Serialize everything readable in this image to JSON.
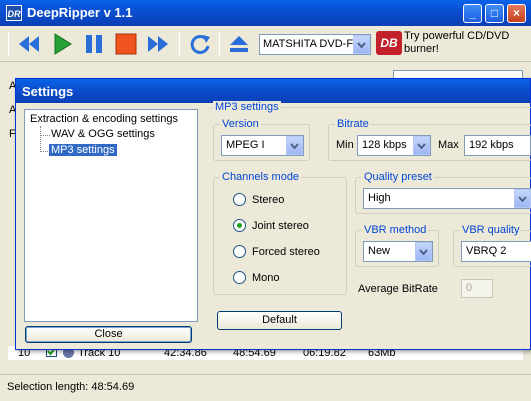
{
  "app": {
    "title": "DeepRipper v 1.1",
    "icon_text": "DR",
    "minimize": "_",
    "maximize": "□",
    "close": "×"
  },
  "toolbar": {
    "buttons": [
      "rewind-icon",
      "play-icon",
      "pause-icon",
      "stop-icon",
      "fast-forward-icon",
      "refresh-icon",
      "eject-icon"
    ],
    "drive": "MATSHITA DVD-F",
    "logo_text": "DB",
    "promo": "Try powerful CD/DVD burner!"
  },
  "background": {
    "labels": [
      "A",
      "A",
      "F"
    ],
    "track_row": {
      "num": "10",
      "name": "Track 10",
      "start": "42:34.86",
      "end": "48:54.69",
      "length": "06:19.82",
      "size": "63Mb"
    },
    "status": "Selection length:  48:54.69"
  },
  "settings": {
    "title": "Settings",
    "tree": {
      "root": "Extraction & encoding settings",
      "children": [
        "WAV & OGG settings",
        "MP3 settings"
      ],
      "selected": "MP3 settings"
    },
    "close_button": "Close",
    "mp3_group": "MP3 settings",
    "version": {
      "label": "Version",
      "value": "MPEG I"
    },
    "bitrate": {
      "label": "Bitrate",
      "min_label": "Min",
      "min": "128 kbps",
      "max_label": "Max",
      "max": "192 kbps"
    },
    "channels": {
      "label": "Channels mode",
      "options": [
        "Stereo",
        "Joint stereo",
        "Forced stereo",
        "Mono"
      ],
      "selected": "Joint stereo"
    },
    "quality": {
      "label": "Quality preset",
      "value": "High"
    },
    "vbr_method": {
      "label": "VBR method",
      "value": "New"
    },
    "vbr_quality": {
      "label": "VBR quality",
      "value": "VBRQ 2"
    },
    "avg_bitrate": {
      "label": "Average BitRate",
      "value": "0"
    },
    "default_button": "Default"
  },
  "colors": {
    "titlebar": "#0a4fd1",
    "selection": "#316ac5",
    "group_label": "#0046d5"
  }
}
